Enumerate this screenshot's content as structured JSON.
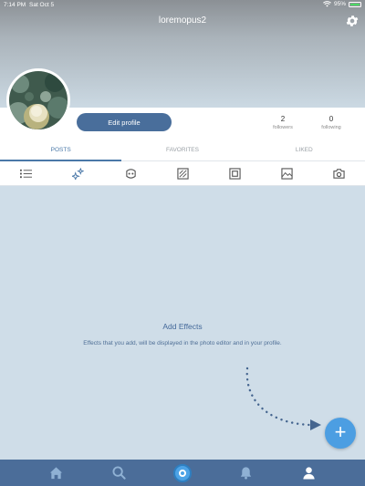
{
  "status_bar": {
    "time": "7:14 PM",
    "date": "Sat Oct 5",
    "battery": "95%"
  },
  "profile": {
    "username": "loremopus2",
    "edit_label": "Edit profile",
    "followers_count": "2",
    "followers_label": "followers",
    "following_count": "0",
    "following_label": "following"
  },
  "tabs": [
    {
      "label": "POSTS",
      "active": true
    },
    {
      "label": "FAVORITES",
      "active": false
    },
    {
      "label": "LIKED",
      "active": false
    }
  ],
  "filter_icons": [
    "list-icon",
    "effects-sparkle-icon",
    "mask-icon",
    "pattern-icon",
    "frame-icon",
    "image-icon",
    "camera-icon"
  ],
  "empty_state": {
    "title": "Add Effects",
    "description": "Effects that you add, will be displayed in the photo editor and in your profile."
  },
  "fab": {
    "symbol": "+"
  },
  "bottom_nav": [
    "home-icon",
    "search-icon",
    "create-icon",
    "bell-icon",
    "profile-icon"
  ],
  "colors": {
    "accent": "#4a78a8",
    "nav": "#4b6d99",
    "fab": "#4c9ee2",
    "button": "#496e9b",
    "background": "#cfdde8"
  }
}
